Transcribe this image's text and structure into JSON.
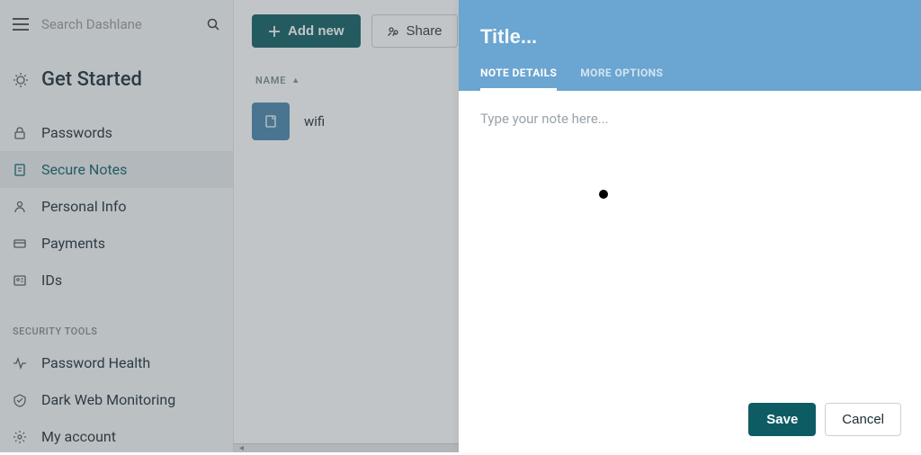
{
  "search": {
    "placeholder": "Search Dashlane"
  },
  "nav": {
    "get_started": "Get Started",
    "items": [
      {
        "label": "Passwords"
      },
      {
        "label": "Secure Notes"
      },
      {
        "label": "Personal Info"
      },
      {
        "label": "Payments"
      },
      {
        "label": "IDs"
      }
    ],
    "section_label": "SECURITY TOOLS",
    "tools": [
      {
        "label": "Password Health"
      },
      {
        "label": "Dark Web Monitoring"
      },
      {
        "label": "My account"
      }
    ]
  },
  "toolbar": {
    "add_label": "Add new",
    "share_label": "Share"
  },
  "list": {
    "column_header": "NAME",
    "items": [
      {
        "name": "wifi"
      }
    ]
  },
  "editor": {
    "title_placeholder": "Title...",
    "tabs": [
      {
        "label": "NOTE DETAILS"
      },
      {
        "label": "MORE OPTIONS"
      }
    ],
    "body_placeholder": "Type your note here...",
    "save_label": "Save",
    "cancel_label": "Cancel"
  }
}
